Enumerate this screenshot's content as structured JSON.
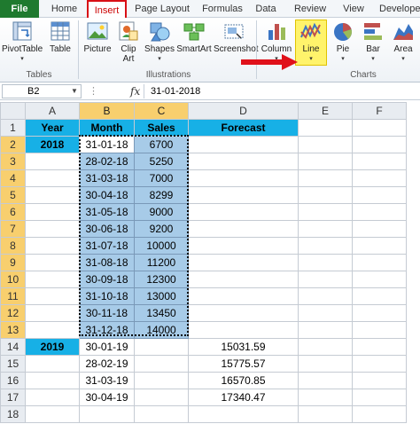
{
  "ribbon_tabs": [
    "File",
    "Home",
    "Insert",
    "Page Layout",
    "Formulas",
    "Data",
    "Review",
    "View",
    "Develope"
  ],
  "ribbon_buttons": {
    "pivottable": "PivotTable",
    "table": "Table",
    "picture": "Picture",
    "clipart_1": "Clip",
    "clipart_2": "Art",
    "shapes": "Shapes",
    "smartart": "SmartArt",
    "screenshot": "Screenshot",
    "column": "Column",
    "line": "Line",
    "pie": "Pie",
    "bar": "Bar",
    "area": "Area"
  },
  "ribbon_groups": [
    "Tables",
    "Illustrations",
    "Charts"
  ],
  "formula_bar": {
    "name_box": "B2",
    "fx": "fx",
    "value": "31-01-2018"
  },
  "columns": [
    "A",
    "B",
    "C",
    "D",
    "E",
    "F"
  ],
  "headers": {
    "year": "Year",
    "month": "Month",
    "sales": "Sales",
    "forecast": "Forecast"
  },
  "rows": [
    {
      "n": "2",
      "a": "2018",
      "b": "31-01-18",
      "c": "6700",
      "d": ""
    },
    {
      "n": "3",
      "a": "",
      "b": "28-02-18",
      "c": "5250",
      "d": ""
    },
    {
      "n": "4",
      "a": "",
      "b": "31-03-18",
      "c": "7000",
      "d": ""
    },
    {
      "n": "5",
      "a": "",
      "b": "30-04-18",
      "c": "8299",
      "d": ""
    },
    {
      "n": "6",
      "a": "",
      "b": "31-05-18",
      "c": "9000",
      "d": ""
    },
    {
      "n": "7",
      "a": "",
      "b": "30-06-18",
      "c": "9200",
      "d": ""
    },
    {
      "n": "8",
      "a": "",
      "b": "31-07-18",
      "c": "10000",
      "d": ""
    },
    {
      "n": "9",
      "a": "",
      "b": "31-08-18",
      "c": "11200",
      "d": ""
    },
    {
      "n": "10",
      "a": "",
      "b": "30-09-18",
      "c": "12300",
      "d": ""
    },
    {
      "n": "11",
      "a": "",
      "b": "31-10-18",
      "c": "13000",
      "d": ""
    },
    {
      "n": "12",
      "a": "",
      "b": "30-11-18",
      "c": "13450",
      "d": ""
    },
    {
      "n": "13",
      "a": "",
      "b": "31-12-18",
      "c": "14000",
      "d": ""
    },
    {
      "n": "14",
      "a": "2019",
      "b": "30-01-19",
      "c": "",
      "d": "15031.59"
    },
    {
      "n": "15",
      "a": "",
      "b": "28-02-19",
      "c": "",
      "d": "15775.57"
    },
    {
      "n": "16",
      "a": "",
      "b": "31-03-19",
      "c": "",
      "d": "16570.85"
    },
    {
      "n": "17",
      "a": "",
      "b": "30-04-19",
      "c": "",
      "d": "17340.47"
    },
    {
      "n": "18",
      "a": "",
      "b": "",
      "c": "",
      "d": ""
    }
  ],
  "colors": {
    "header_fill": "#17b0e6",
    "selection_fill": "#a7cbe8",
    "insert_highlight": "#d80f16",
    "line_highlight": "#fff36b",
    "file_tab": "#1f7a2f"
  },
  "icons": [
    "pivottable-icon",
    "table-icon",
    "picture-icon",
    "clipart-icon",
    "shapes-icon",
    "smartart-icon",
    "screenshot-icon",
    "column-chart-icon",
    "line-chart-icon",
    "pie-chart-icon",
    "bar-chart-icon",
    "area-chart-icon",
    "red-arrow-icon"
  ]
}
